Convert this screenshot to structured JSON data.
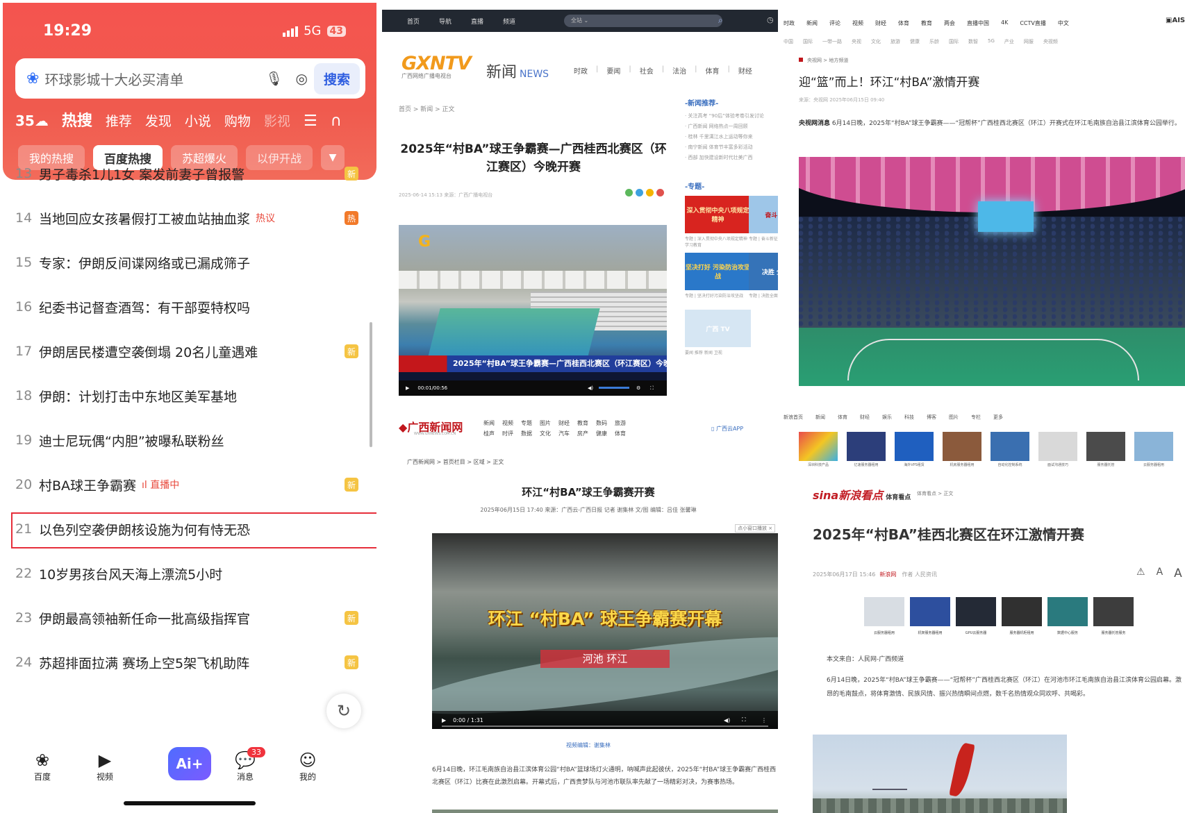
{
  "phone": {
    "status": {
      "time": "19:29",
      "network": "5G",
      "battery": "43"
    },
    "search": {
      "placeholder": "环球影城十大必买清单",
      "button": "搜索"
    },
    "tabs": {
      "weather": "35",
      "items": [
        "热搜",
        "推荐",
        "发现",
        "小说",
        "购物",
        "影视"
      ],
      "active": "热搜"
    },
    "chips": {
      "items": [
        "我的热搜",
        "百度热搜",
        "苏超爆火",
        "以伊开战"
      ],
      "active": "百度热搜"
    },
    "hot_list": [
      {
        "rank": "13",
        "title": "男子毒杀1儿1女 案发前妻子曾报警",
        "tag": "",
        "badge": "新"
      },
      {
        "rank": "14",
        "title": "当地回应女孩暑假打工被血站抽血浆",
        "tag": "热议",
        "badge": "热"
      },
      {
        "rank": "15",
        "title": "专家：伊朗反间谍网络或已漏成筛子",
        "tag": "",
        "badge": ""
      },
      {
        "rank": "16",
        "title": "纪委书记督查酒驾：有干部耍特权吗",
        "tag": "",
        "badge": ""
      },
      {
        "rank": "17",
        "title": "伊朗居民楼遭空袭倒塌 20名儿童遇难",
        "tag": "",
        "badge": "新"
      },
      {
        "rank": "18",
        "title": "伊朗：计划打击中东地区美军基地",
        "tag": "",
        "badge": ""
      },
      {
        "rank": "19",
        "title": "迪士尼玩偶“内胆”被曝私联粉丝",
        "tag": "",
        "badge": ""
      },
      {
        "rank": "20",
        "title": "村BA球王争霸赛",
        "tag": "直播中",
        "badge": "新"
      },
      {
        "rank": "21",
        "title": "以色列空袭伊朗核设施为何有恃无恐",
        "tag": "",
        "badge": ""
      },
      {
        "rank": "22",
        "title": "10岁男孩台风天海上漂流5小时",
        "tag": "",
        "badge": ""
      },
      {
        "rank": "23",
        "title": "伊朗最高领袖新任命一批高级指挥官",
        "tag": "",
        "badge": "新"
      },
      {
        "rank": "24",
        "title": "苏超排面拉满 赛场上空5架飞机助阵",
        "tag": "",
        "badge": "新"
      }
    ],
    "bottom_nav": [
      {
        "label": "百度",
        "icon": "paw-icon"
      },
      {
        "label": "视频",
        "icon": "play-icon"
      },
      {
        "label": "Ai+",
        "icon": "ai-icon"
      },
      {
        "label": "消息",
        "icon": "chat-icon",
        "badge": "33"
      },
      {
        "label": "我的",
        "icon": "face-icon"
      }
    ]
  },
  "gxntv": {
    "topbar": [
      "首页",
      "导航",
      "直播",
      "频道"
    ],
    "search_scope": "全站",
    "logo": "GXNTV",
    "logo_sub": "广西网络广播电视台",
    "section": "新闻",
    "section_en": "NEWS",
    "nav": [
      "时政",
      "要闻",
      "社会",
      "法治",
      "体育",
      "财经"
    ],
    "breadcrumb": "首页 > 新闻 > 正文",
    "title": "2025年“村BA”球王争霸赛—广西桂西北赛区（环江赛区）今晚开赛",
    "meta": "2025-06-14 15:13     来源：广西广播电视台",
    "video_banner": "2025年“村BA”球王争霸赛—广西桂西北赛区（环江赛区）今晚开赛",
    "video_time": "00:01/00:56",
    "side_recommend_title": "新闻推荐",
    "side_recommend": [
      "· 关注高考 “90后”体验考卷引发讨论",
      "· 广西新闻 网络热点一周回顾",
      "· 桂林 千里漓江水上运动等你来",
      "· 南宁新闻 体育节丰富多彩活动",
      "· 西部 加快建设新时代壮美广西"
    ],
    "side_topic_title": "专题",
    "side_tiles": [
      {
        "text": "深入贯彻中央八项规定精神",
        "caption": "专题 | 深入贯彻中央八项规定精神学习教育",
        "bg": "#d8241f",
        "fg": "#ffe7a6"
      },
      {
        "text": "奋斗 新征程",
        "caption": "专题 | 奋斗新征程",
        "bg": "#9ec6e8",
        "fg": "#c0161c"
      },
      {
        "text": "坚决打好 污染防治攻坚战",
        "caption": "专题 | 坚决打好污染防治攻坚战",
        "bg": "#2a78c9",
        "fg": "#ffd54d"
      },
      {
        "text": "决胜 全面小康",
        "caption": "专题 | 决胜全面小康",
        "bg": "#3573b8",
        "fg": "#ffffff"
      },
      {
        "text": "广西 TV",
        "caption": "要闻  推荐  新闻  卫视",
        "bg": "#d6e6f3",
        "fg": "#ffffff"
      }
    ]
  },
  "gxnews": {
    "logo": "广西新闻网",
    "logo_sub": "WWW.GXNEWS.COM.CN",
    "nav": [
      "新闻",
      "视频",
      "专题",
      "图片",
      "财经",
      "教育",
      "数码",
      "旅游",
      "桂声",
      "时评",
      "数据",
      "文化",
      "汽车",
      "房产",
      "健康",
      "体育"
    ],
    "app_label": "广西云APP",
    "breadcrumb": "广西新闻网 > 首页栏目 > 区域 > 正文",
    "title": "环江“村BA”球王争霸赛开赛",
    "meta": "2025年06月15日 17:40   来源：广西云-广西日报   记者 谢集林 文/图   编辑：吕佳 张馨琳",
    "video_tag": "点小窗口播放",
    "video_title": "环江 “村BA” 球王争霸赛开幕",
    "video_place": "河池 环江",
    "video_time": "0:00 / 1:31",
    "editor": "视频编辑：谢集林",
    "body": "6月14日晚，环江毛南族自治县江滨体育公园“村BA”篮球场灯火通明，呐喊声此起彼伏，2025年“村BA”球王争霸赛广西桂西北赛区（环江）比赛在此激烈启幕。开幕式后，广西贵梦队与河池市联队率先献了一场精彩对决，为赛事热场。"
  },
  "cctv": {
    "nav1": [
      "时政",
      "新闻",
      "评论",
      "视频",
      "财经",
      "体育",
      "教育",
      "两会",
      "直播中国",
      "4K",
      "CCTV直播",
      "中文"
    ],
    "nav2": [
      "中国",
      "国际",
      "一带一路",
      "央视",
      "文化",
      "旅游",
      "健康",
      "乐龄",
      "国际",
      "数智",
      "5G",
      "产业",
      "网服",
      "央视频"
    ],
    "breadcrumb": "央视网 > 地方频道",
    "title": "迎“篮”而上！环江“村BA”激情开赛",
    "meta": "来源：央视网   2025年06月15日 09:40",
    "lead_source": "央视网消息",
    "lead": "6月14日晚，2025年“村BA”球王争霸赛——“冠帮杯”广西桂西北赛区（环江）开赛式在环江毛南族自治县江滨体育公园举行。",
    "sina_nav": [
      "新浪首页",
      "新闻",
      "体育",
      "财经",
      "娱乐",
      "科技",
      "博客",
      "图片",
      "专栏",
      "更多"
    ],
    "thumb_captions": [
      "深圳科技产品",
      "亿速服务器租用",
      "海外VPS租赁",
      "机房服务器租用",
      "自动化控制系统",
      "面试沟通技巧",
      "服务器托管",
      "云服务器租用"
    ]
  },
  "sina": {
    "logo": "sina新浪看点",
    "logo_sub": "体育看点",
    "breadcrumb": "体育看点 > 正文",
    "title": "2025年“村BA”桂西北赛区在环江激情开赛",
    "meta": "2025年06月17日 15:46",
    "meta_source": "新浪网",
    "meta_author": "作者 人民资讯",
    "ad_captions": [
      "云服务器租用",
      "机架服务器租用",
      "GPU云服务器",
      "服务器机柜租用",
      "数据中心服务",
      "服务器托管服务"
    ],
    "source": "本文来自：人民网-广西频道",
    "body": "6月14日晚，2025年“村BA”球王争霸赛——“冠帮杯”广西桂西北赛区（环江）在河池市环江毛南族自治县江滨体育公园启幕。激昂的毛南鼓点，将体育激情、民族风情、振兴热情瞬间点燃，数千名热情观众同欢呼、共喝彩。"
  }
}
